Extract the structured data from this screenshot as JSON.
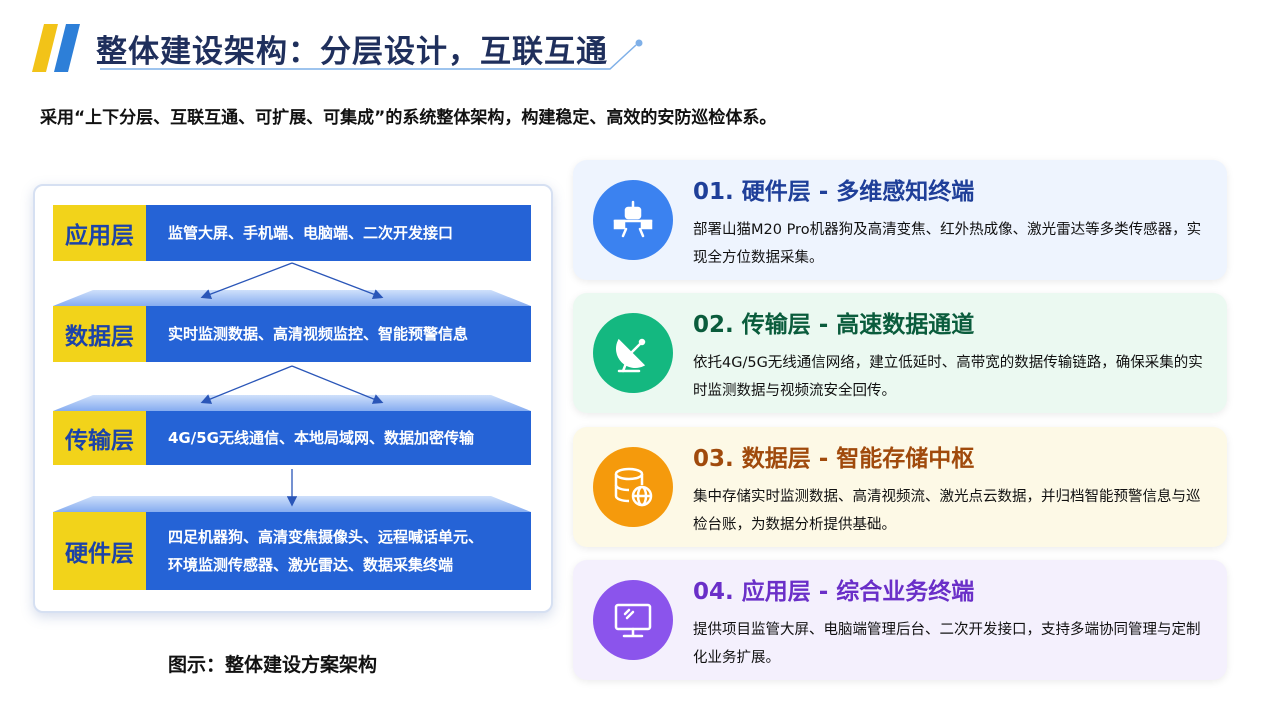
{
  "header": {
    "title": "整体建设架构：分层设计，互联互通",
    "subtitle": "采用“上下分层、互联互通、可扩展、可集成”的系统整体架构，构建稳定、高效的安防巡检体系。"
  },
  "diagram": {
    "layers": [
      {
        "tag": "应用层",
        "lines": [
          "监管大屏、手机端、电脑端、二次开发接口"
        ]
      },
      {
        "tag": "数据层",
        "lines": [
          "实时监测数据、高清视频监控、智能预警信息"
        ]
      },
      {
        "tag": "传输层",
        "lines": [
          "4G/5G无线通信、本地局域网、数据加密传输"
        ]
      },
      {
        "tag": "硬件层",
        "lines": [
          "四足机器狗、高清变焦摄像头、远程喊话单元、",
          "环境监测传感器、激光雷达、数据采集终端"
        ]
      }
    ],
    "caption": "图示：整体建设方案架构"
  },
  "cards": [
    {
      "title": "01. 硬件层 - 多维感知终端",
      "desc": "部署山猫M20 Pro机器狗及高清变焦、红外热成像、激光雷达等多类传感器，实现全方位数据采集。",
      "icon": "robot-sensor-icon"
    },
    {
      "title": "02. 传输层 - 高速数据通道",
      "desc": "依托4G/5G无线通信网络，建立低延时、高带宽的数据传输链路，确保采集的实时监测数据与视频流安全回传。",
      "icon": "satellite-dish-icon"
    },
    {
      "title": "03. 数据层 - 智能存储中枢",
      "desc": "集中存储实时监测数据、高清视频流、激光点云数据，并归档智能预警信息与巡检台账，为数据分析提供基础。",
      "icon": "database-globe-icon"
    },
    {
      "title": "04. 应用层 - 综合业务终端",
      "desc": "提供项目监管大屏、电脑端管理后台、二次开发接口，支持多端协同管理与定制化业务扩展。",
      "icon": "monitor-icon"
    }
  ],
  "colors": {
    "accent_blue": "#2563d6",
    "tag_yellow": "#f2d31a",
    "card1_title": "#1f3f99",
    "card2_title": "#0a5c3c",
    "card3_title": "#a04a0c",
    "card4_title": "#6a2fc8"
  }
}
